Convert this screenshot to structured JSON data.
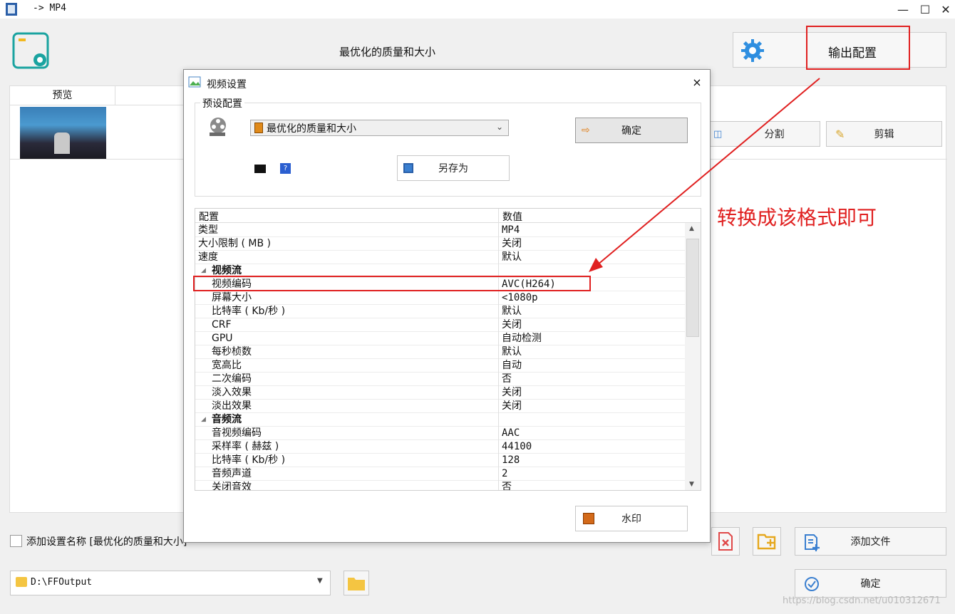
{
  "window": {
    "title": "-> MP4",
    "minimize": "—",
    "maximize": "☐",
    "close": "✕"
  },
  "main": {
    "quality_label": "最优化的质量和大小",
    "output_config_label": "输出配置",
    "preview_header": "预览",
    "split_label": "分割",
    "edit_label": "剪辑",
    "add_file_label": "添加文件",
    "ok_label": "确定",
    "add_setting_name_label": "添加设置名称 [最优化的质量和大小]",
    "output_path": "D:\\FFOutput",
    "annotation": "转换成该格式即可",
    "watermark_text": "https://blog.csdn.net/u010312671"
  },
  "dialog": {
    "title": "视频设置",
    "close": "×",
    "preset_group": "预设配置",
    "preset_value": "最优化的质量和大小",
    "ok_label": "确定",
    "save_as_label": "另存为",
    "watermark_label": "水印",
    "grid_header": {
      "key": "配置",
      "value": "数值"
    },
    "rows": [
      {
        "key": "类型",
        "value": "MP4",
        "indent": 0
      },
      {
        "key": "大小限制 ( MB )",
        "value": "关闭",
        "indent": 0
      },
      {
        "key": "速度",
        "value": "默认",
        "indent": 0
      },
      {
        "key": "视频流",
        "value": "",
        "group": true
      },
      {
        "key": "视频编码",
        "value": "AVC(H264)",
        "indent": 1
      },
      {
        "key": "屏幕大小",
        "value": "<1080p",
        "indent": 1
      },
      {
        "key": "比特率 ( Kb/秒 )",
        "value": "默认",
        "indent": 1
      },
      {
        "key": "CRF",
        "value": "关闭",
        "indent": 1
      },
      {
        "key": "GPU",
        "value": "自动检测",
        "indent": 1
      },
      {
        "key": "每秒桢数",
        "value": "默认",
        "indent": 1
      },
      {
        "key": "宽高比",
        "value": "自动",
        "indent": 1
      },
      {
        "key": "二次编码",
        "value": "否",
        "indent": 1
      },
      {
        "key": "淡入效果",
        "value": "关闭",
        "indent": 1
      },
      {
        "key": "淡出效果",
        "value": "关闭",
        "indent": 1
      },
      {
        "key": "音频流",
        "value": "",
        "group": true
      },
      {
        "key": "音视频编码",
        "value": "AAC",
        "indent": 1
      },
      {
        "key": "采样率 ( 赫兹 )",
        "value": "44100",
        "indent": 1
      },
      {
        "key": "比特率 ( Kb/秒 )",
        "value": "128",
        "indent": 1
      },
      {
        "key": "音频声道",
        "value": "2",
        "indent": 1
      },
      {
        "key": "关闭音效",
        "value": "否",
        "indent": 1
      }
    ]
  }
}
